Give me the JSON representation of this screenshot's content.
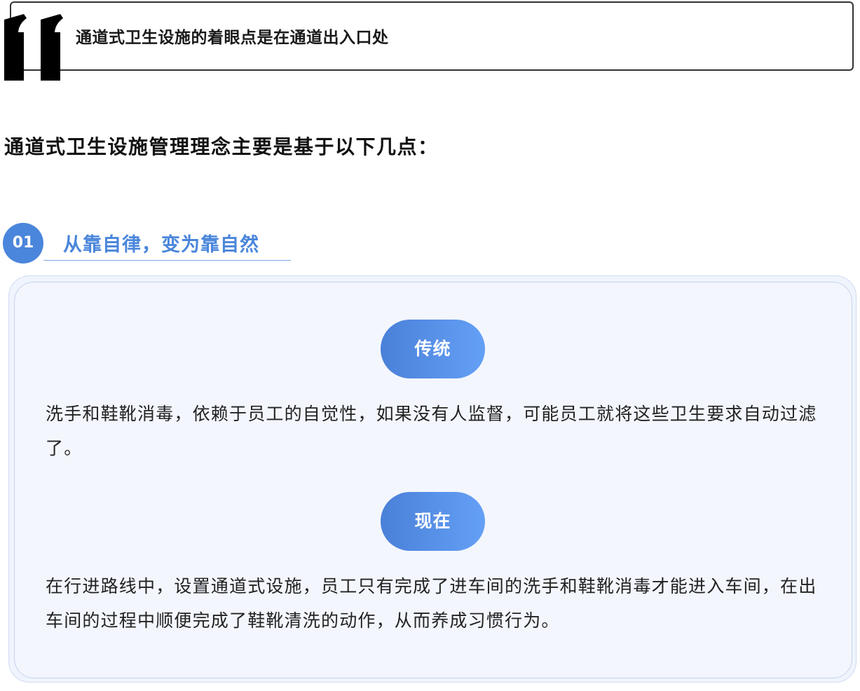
{
  "quote": {
    "title": "通道式卫生设施的着眼点是在通道出入口处"
  },
  "heading": "通道式卫生设施管理理念主要是基于以下几点：",
  "section": {
    "number": "01",
    "title": "从靠自律，变为靠自然",
    "items": [
      {
        "label": "传统",
        "text": "洗手和鞋靴消毒，依赖于员工的自觉性，如果没有人监督，可能员工就将这些卫生要求自动过滤了。"
      },
      {
        "label": "现在",
        "text": "在行进路线中，设置通道式设施，员工只有完成了进车间的洗手和鞋靴消毒才能进入车间，在出车间的过程中顺便完成了鞋靴清洗的动作，从而养成习惯行为。"
      }
    ]
  },
  "colors": {
    "accent": "#4a86db",
    "card_bg": "#f3f6fd",
    "border_dark": "#333333"
  }
}
